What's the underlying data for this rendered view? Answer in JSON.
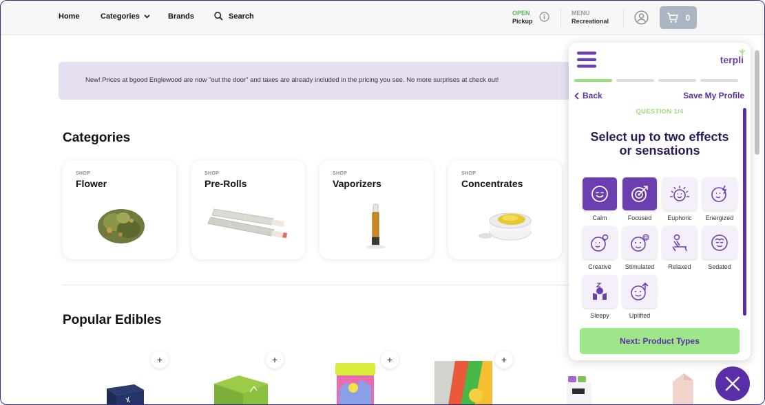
{
  "nav": {
    "home": "Home",
    "categories": "Categories",
    "brands": "Brands",
    "search": "Search",
    "status_open": "OPEN",
    "status_pickup": "Pickup",
    "menu_label": "MENU",
    "menu_value": "Recreational",
    "cart_count": "0"
  },
  "banner": {
    "text": "New! Prices at bgood Englewood are now \"out the door\" and taxes are already included in the pricing you see. No more surprises at check out!"
  },
  "sections": {
    "categories_title": "Categories",
    "edibles_title": "Popular Edibles"
  },
  "categories": [
    {
      "shop": "SHOP",
      "name": "Flower"
    },
    {
      "shop": "SHOP",
      "name": "Pre-Rolls"
    },
    {
      "shop": "SHOP",
      "name": "Vaporizers"
    },
    {
      "shop": "SHOP",
      "name": "Concentrates"
    }
  ],
  "add_button_label": "+",
  "terpli": {
    "logo": "terpli",
    "back": "Back",
    "save_profile": "Save My Profile",
    "question": "QUESTION 1/4",
    "prompt_line1": "Select up to two effects",
    "prompt_line2": "or sensations",
    "progress_active": 1,
    "progress_total": 4,
    "effects": [
      {
        "label": "Calm",
        "selected": true,
        "icon": "calm-icon"
      },
      {
        "label": "Focused",
        "selected": true,
        "icon": "focused-icon"
      },
      {
        "label": "Euphoric",
        "selected": false,
        "icon": "euphoric-icon"
      },
      {
        "label": "Energized",
        "selected": false,
        "icon": "energized-icon"
      },
      {
        "label": "Creative",
        "selected": false,
        "icon": "creative-icon"
      },
      {
        "label": "Stimulated",
        "selected": false,
        "icon": "stimulated-icon"
      },
      {
        "label": "Relaxed",
        "selected": false,
        "icon": "relaxed-icon"
      },
      {
        "label": "Sedated",
        "selected": false,
        "icon": "sedated-icon"
      },
      {
        "label": "Sleepy",
        "selected": false,
        "icon": "sleepy-icon"
      },
      {
        "label": "Uplifted",
        "selected": false,
        "icon": "uplifted-icon"
      }
    ],
    "next_button": "Next: Product Types"
  },
  "colors": {
    "brand_purple": "#5a2ea6",
    "selected_purple": "#6b3fb0",
    "green": "#96e07e",
    "banner_bg": "#e6dff2"
  }
}
